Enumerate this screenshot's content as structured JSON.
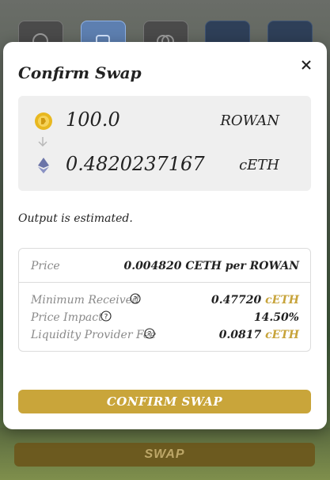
{
  "modal": {
    "title": "Confirm Swap",
    "from": {
      "amount": "100.0",
      "symbol": "ROWAN"
    },
    "to": {
      "amount": "0.4820237167",
      "symbol": "cETH"
    },
    "note": "Output is estimated.",
    "details": {
      "price_label": "Price",
      "price_value": "0.004820 CETH per ROWAN",
      "min_received_label": "Minimum Received",
      "min_received_value": "0.47720",
      "min_received_symbol": "cETH",
      "price_impact_label": "Price Impact",
      "price_impact_value": "14.50%",
      "lp_fee_label": "Liquidity Provider Fee",
      "lp_fee_value": "0.0817",
      "lp_fee_symbol": "cETH"
    },
    "confirm_label": "CONFIRM SWAP"
  },
  "background": {
    "swap_label": "SWAP"
  },
  "colors": {
    "accent": "#c9a53a",
    "modal_bg": "#ffffff",
    "token_box_bg": "#efefef"
  }
}
